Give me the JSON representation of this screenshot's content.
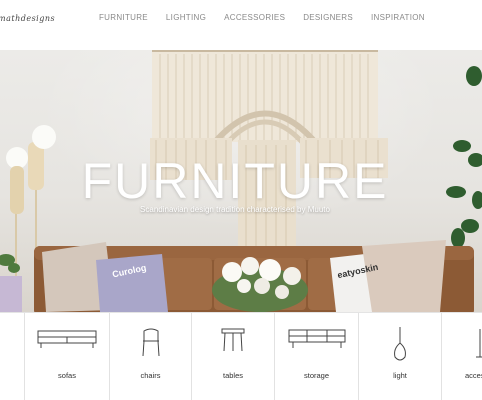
{
  "header": {
    "logo_text": "mathdesigns",
    "nav": [
      "FURNITURE",
      "LIGHTING",
      "ACCESSORIES",
      "DESIGNERS",
      "INSPIRATION"
    ]
  },
  "hero": {
    "title": "FURNITURE",
    "subtitle": "Scandinavian design tradition characterised by Muuto",
    "pillow_left_text": "Curolog",
    "pillow_right_text": "eatyoskin"
  },
  "categories": [
    "sofas",
    "chairs",
    "tables",
    "storage",
    "light",
    "acces"
  ],
  "colors": {
    "nav_text": "#8a8a8a",
    "hero_text": "#ffffff",
    "sofa": "#8c5a35",
    "macrame": "#ece4d6"
  }
}
